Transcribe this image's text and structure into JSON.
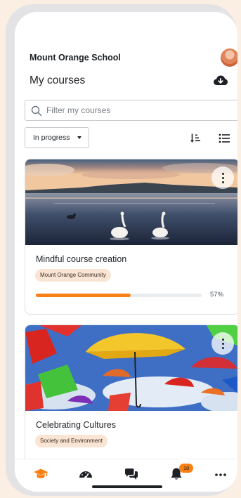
{
  "header": {
    "school_name": "Mount Orange School",
    "page_title": "My courses"
  },
  "search": {
    "placeholder": "Filter my courses",
    "value": ""
  },
  "filters": {
    "status_selected": "In progress"
  },
  "courses": [
    {
      "name": "Mindful course creation",
      "category": "Mount Orange Community",
      "progress": 0.57,
      "progress_label": "57%",
      "image": "swans-on-lake-at-sunset"
    },
    {
      "name": "Celebrating Cultures",
      "category": "Society and Environment",
      "image": "colorful-umbrellas"
    }
  ],
  "tabbar": {
    "items": [
      "home-icon",
      "dashboard-icon",
      "messages-icon",
      "notifications-icon",
      "more-icon"
    ],
    "notification_count": "18"
  },
  "colors": {
    "accent": "#f98012",
    "badge_background": "#fae5d4",
    "page_background": "#fbeee2"
  }
}
